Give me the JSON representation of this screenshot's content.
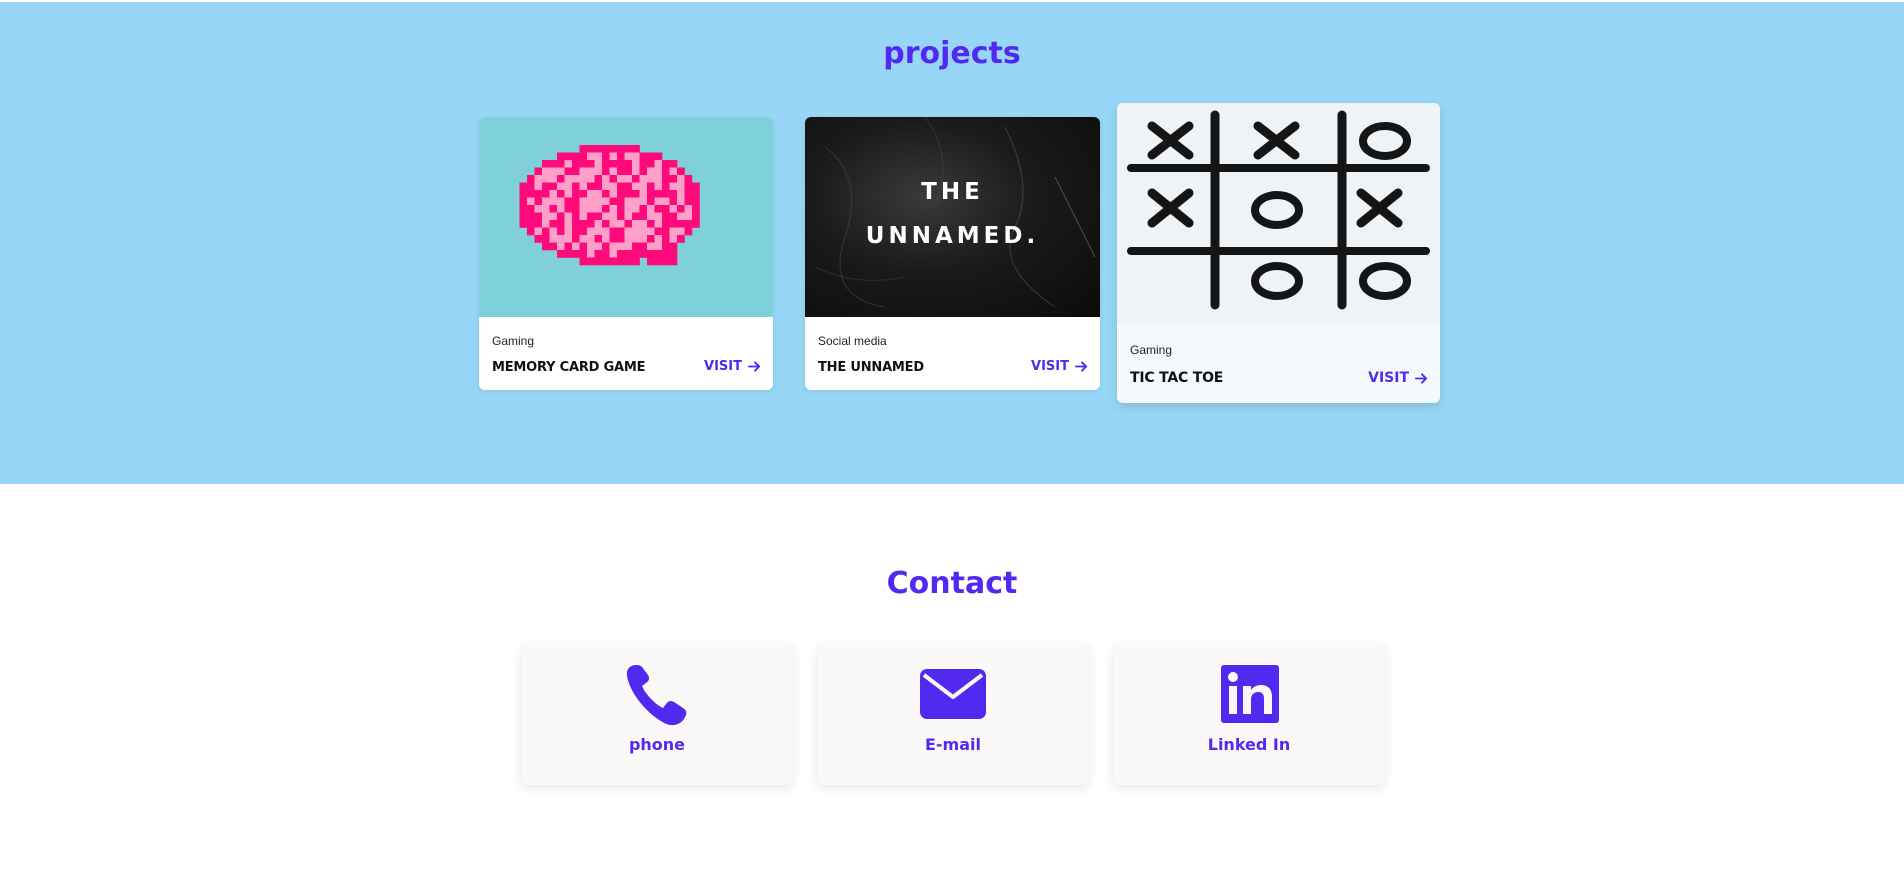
{
  "projects": {
    "title": "projects",
    "cards": [
      {
        "category": "Gaming",
        "name": "MEMORY CARD GAME",
        "visit": "VISIT"
      },
      {
        "category": "Social media",
        "name": "THE UNNAMED",
        "visit": "VISIT",
        "image_text_line1": "THE",
        "image_text_line2": "UNNAMED."
      },
      {
        "category": "Gaming",
        "name": "TIC TAC TOE",
        "visit": "VISIT"
      }
    ]
  },
  "contact": {
    "title": "Contact",
    "items": [
      {
        "label": "phone",
        "icon": "phone-icon"
      },
      {
        "label": "E-mail",
        "icon": "email-icon"
      },
      {
        "label": "Linked In",
        "icon": "linkedin-icon"
      }
    ]
  },
  "colors": {
    "accent": "#5229f0",
    "projects_bg": "#97d6f6",
    "brain_pink": "#ff0a7a",
    "brain_light": "#ffa0c8",
    "memory_bg": "#7fd0d8"
  }
}
